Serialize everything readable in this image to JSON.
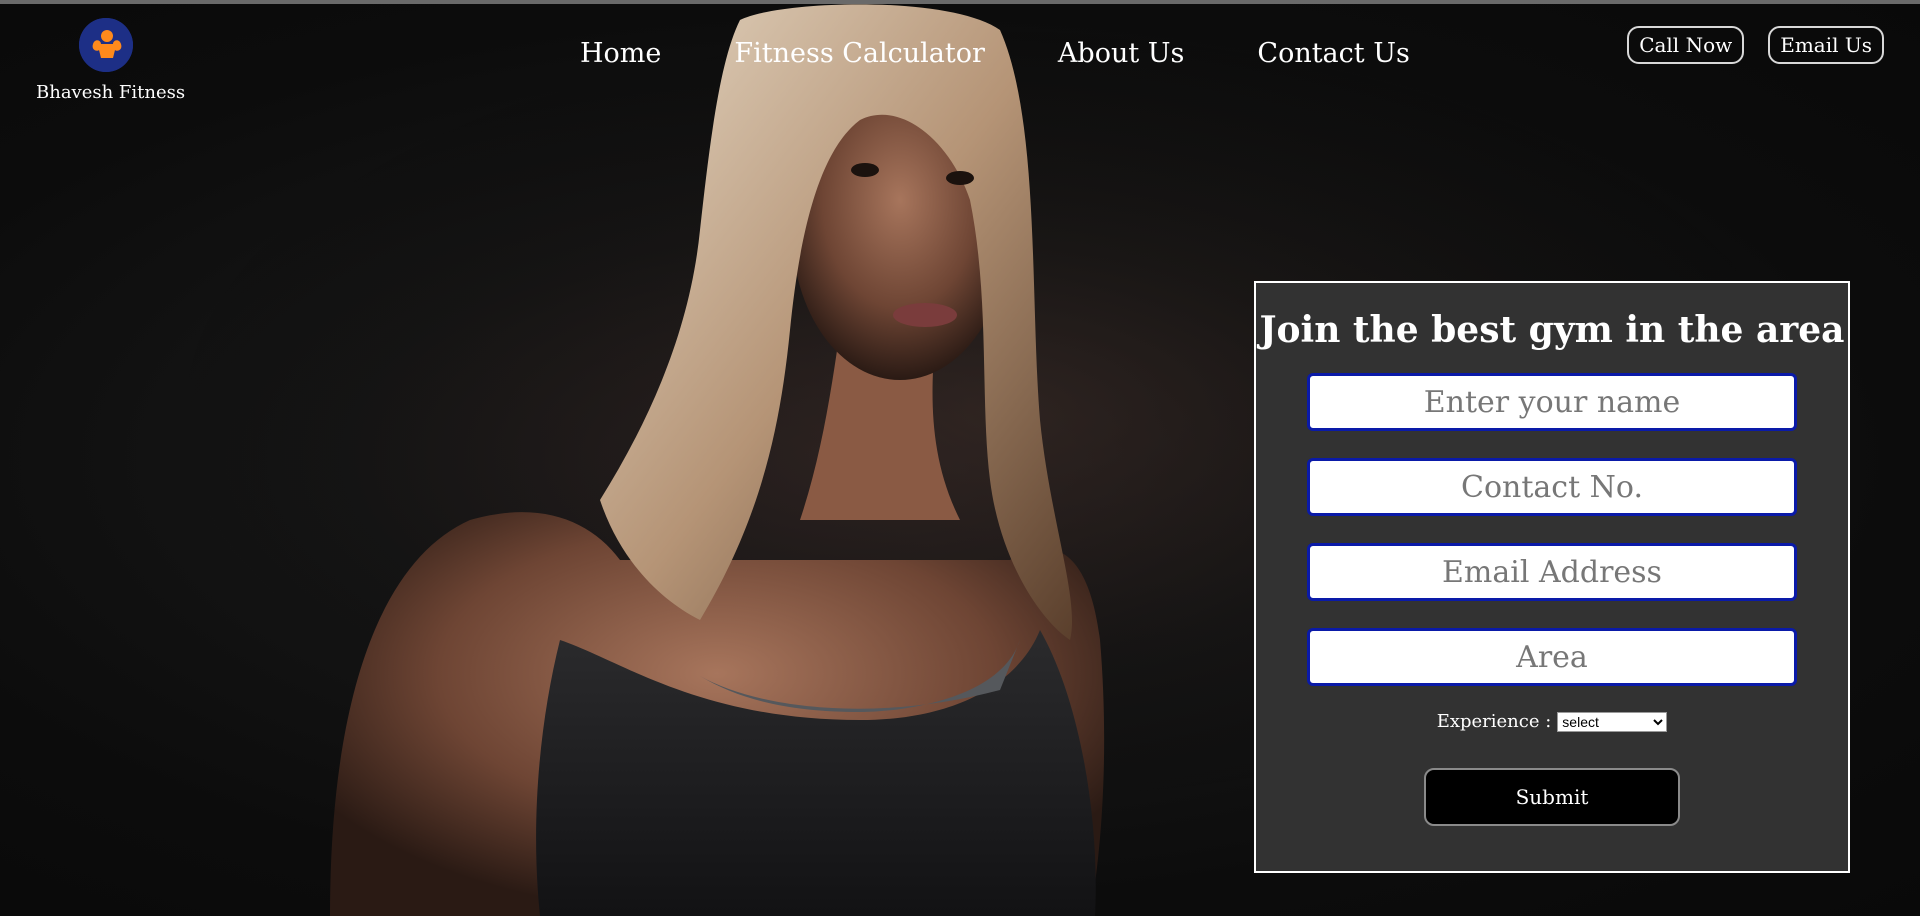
{
  "brand": {
    "name": "Bhavesh Fitness",
    "logo_icon": "flexing-bodybuilder-icon",
    "logo_bg": "#1d2f86",
    "logo_fg": "#ff8a1c"
  },
  "nav": {
    "items": [
      {
        "label": "Home"
      },
      {
        "label": "Fitness Calculator"
      },
      {
        "label": "About Us"
      },
      {
        "label": "Contact Us"
      }
    ]
  },
  "actions": {
    "call_label": "Call Now",
    "email_label": "Email Us"
  },
  "form": {
    "title": "Join the best gym in the area",
    "name_placeholder": "Enter your name",
    "contact_placeholder": "Contact No.",
    "email_placeholder": "Email Address",
    "area_placeholder": "Area",
    "experience_label": "Experience :",
    "experience_selected": "select",
    "submit_label": "Submit",
    "input_border": "#0a1aa8",
    "panel_bg": "#323232"
  }
}
